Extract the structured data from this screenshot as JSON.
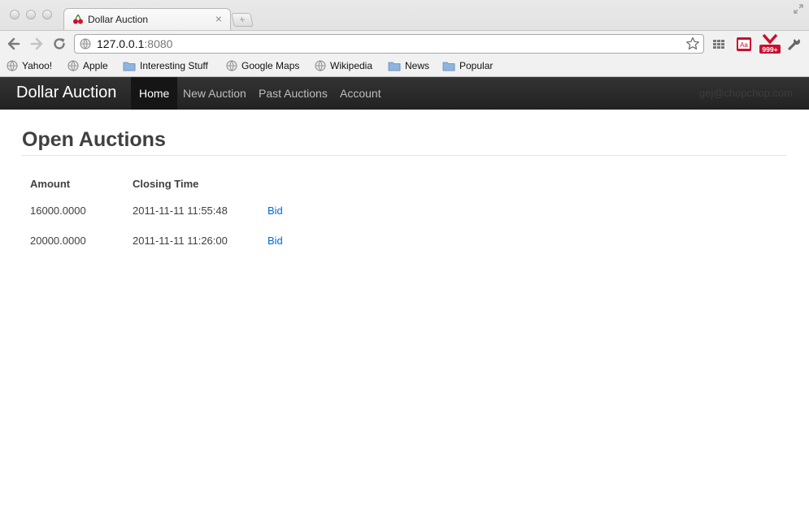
{
  "browser": {
    "tab_title": "Dollar Auction",
    "new_tab_symbol": "+",
    "url_host": "127.0.0.1",
    "url_port": ":8080",
    "close_symbol": "×",
    "extension_badge": "999+",
    "extension_dict_label": "Aa",
    "bookmarks": [
      {
        "label": "Yahoo!",
        "icon": "globe-icon"
      },
      {
        "label": "Apple",
        "icon": "globe-icon"
      },
      {
        "label": "Interesting Stuff",
        "icon": "folder-icon"
      },
      {
        "label": "Google Maps",
        "icon": "globe-icon"
      },
      {
        "label": "Wikipedia",
        "icon": "globe-icon"
      },
      {
        "label": "News",
        "icon": "folder-icon"
      },
      {
        "label": "Popular",
        "icon": "folder-icon"
      }
    ]
  },
  "navbar": {
    "brand": "Dollar Auction",
    "items": [
      "Home",
      "New Auction",
      "Past Auctions",
      "Account"
    ],
    "active_item": "Home",
    "user_email": "gej@chopchop.com"
  },
  "main": {
    "title": "Open Auctions",
    "table": {
      "headers": [
        "Amount",
        "Closing Time"
      ],
      "rows": [
        {
          "amount": "16000.0000",
          "closing_time": "2011-11-11 11:55:48",
          "action": "Bid"
        },
        {
          "amount": "20000.0000",
          "closing_time": "2011-11-11 11:26:00",
          "action": "Bid"
        }
      ]
    }
  },
  "colors": {
    "navbar_bg": "#222222",
    "link": "#0069d6",
    "text": "#404040"
  }
}
